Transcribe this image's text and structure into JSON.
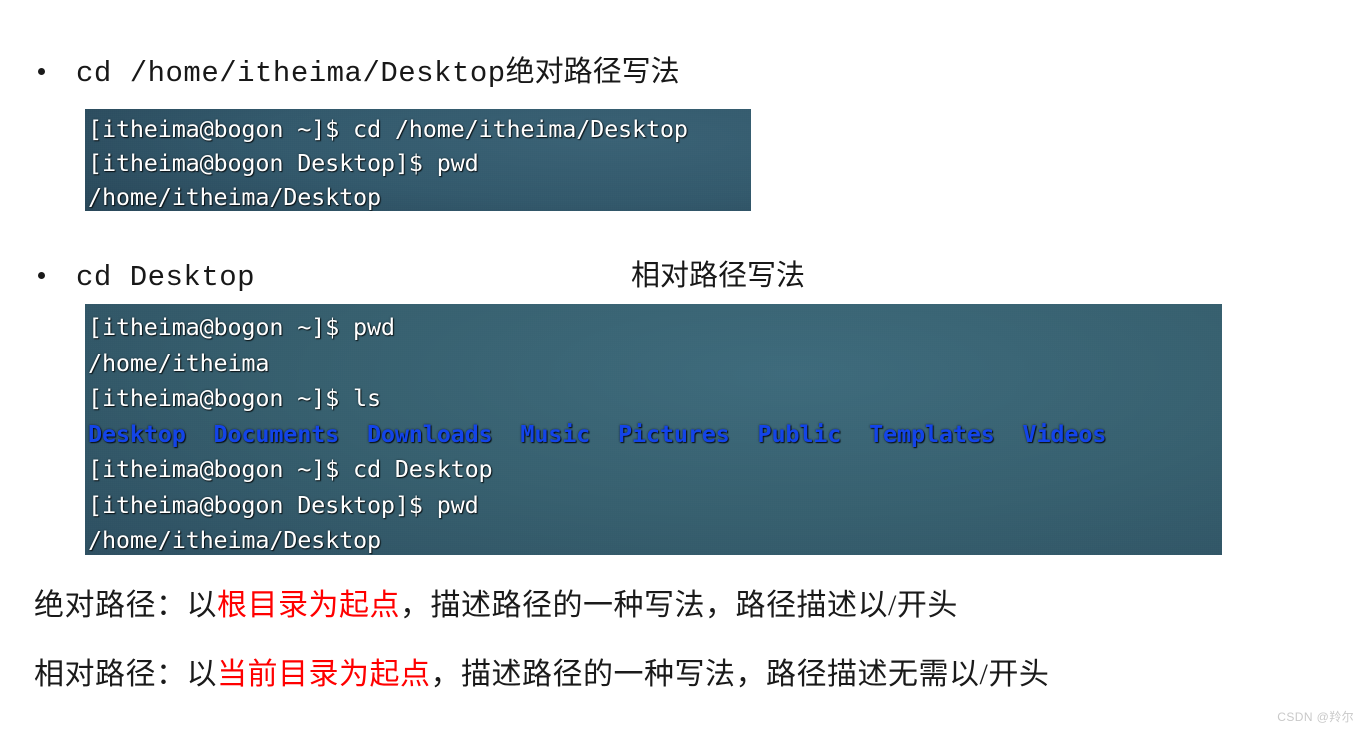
{
  "slide": {
    "background_color": "#ffffff",
    "accent_red": "#ff0000",
    "terminal_blue": "#1344e8"
  },
  "bullets": [
    {
      "marker": "•",
      "command": "cd /home/itheima/Desktop",
      "annotation": "绝对路径写法"
    },
    {
      "marker": "•",
      "command": "cd Desktop",
      "annotation": "相对路径写法"
    }
  ],
  "terminals": [
    {
      "name": "absolute-path-terminal",
      "lines": [
        {
          "text": "[itheima@bogon ~]$ cd /home/itheima/Desktop",
          "style": "normal"
        },
        {
          "text": "[itheima@bogon Desktop]$ pwd",
          "style": "normal"
        },
        {
          "text": "/home/itheima/Desktop",
          "style": "normal"
        }
      ]
    },
    {
      "name": "relative-path-terminal",
      "lines": [
        {
          "text": "[itheima@bogon ~]$ pwd",
          "style": "normal"
        },
        {
          "text": "/home/itheima",
          "style": "normal"
        },
        {
          "text": "[itheima@bogon ~]$ ls",
          "style": "normal"
        },
        {
          "text": "Desktop  Documents  Downloads  Music  Pictures  Public  Templates  Videos",
          "style": "dir"
        },
        {
          "text": "[itheima@bogon ~]$ cd Desktop",
          "style": "normal"
        },
        {
          "text": "[itheima@bogon Desktop]$ pwd",
          "style": "normal"
        },
        {
          "text": "/home/itheima/Desktop",
          "style": "normal"
        }
      ]
    }
  ],
  "notes": [
    {
      "lead": "绝对路径：以",
      "highlight": "根目录为起点",
      "tail": "，描述路径的一种写法，路径描述以/开头"
    },
    {
      "lead": "相对路径：以",
      "highlight": "当前目录为起点",
      "tail": "，描述路径的一种写法，路径描述无需以/开头"
    }
  ],
  "watermark": {
    "text": "CSDN @羚尔"
  }
}
